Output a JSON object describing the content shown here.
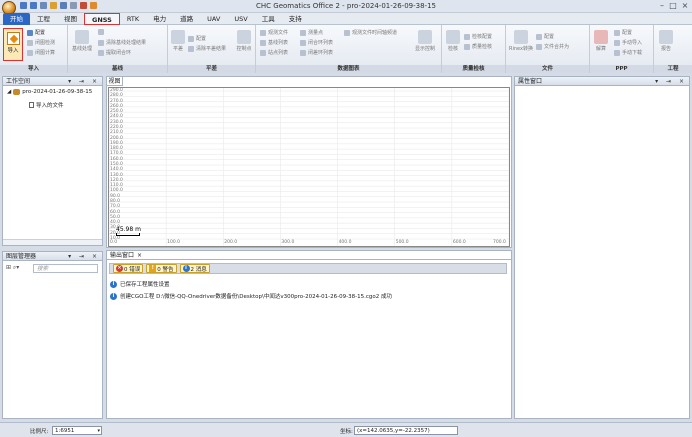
{
  "window": {
    "title": "CHC Geomatics Office 2 - pro-2024-01-26-09-38-15"
  },
  "tabs": [
    "开始",
    "工程",
    "视图",
    "GNSS",
    "RTK",
    "电力",
    "道路",
    "UAV",
    "USV",
    "工具",
    "支持"
  ],
  "ribbon": {
    "import_label": "导入",
    "col1": [
      "配置",
      "闭图检测",
      "闭图计算"
    ],
    "group_project": "导入",
    "col2": [
      "基线处理",
      "清除基线处理结果",
      "提取闭合环"
    ],
    "group_baseline": "基线",
    "col3": [
      "平差",
      "配置",
      "清除平差结果",
      "控制点"
    ],
    "group_adjust": "平差",
    "col4": [
      "观测文件",
      "基线列表",
      "站点列表",
      "测量点",
      "闭合环列表",
      "闭差环列表",
      "观测文件时间轴频道"
    ],
    "show_control": "显示控制",
    "group_table": "数据图表",
    "col5": [
      "检核",
      "检核配置",
      "质量检核"
    ],
    "group_quality": "质量检核",
    "col6": [
      "Rinex转换",
      "配置",
      "文件合并为"
    ],
    "group_file": "文件",
    "col7": [
      "PPP",
      "解算",
      "配置",
      "手动导入",
      "手动下载"
    ],
    "group_ppp": "PPP",
    "col8": [
      "报告"
    ],
    "group_project2": "工程"
  },
  "workspace": {
    "title": "工作空间",
    "project": "pro-2024-01-26-09-38-15",
    "child": "导入的文件"
  },
  "layers": {
    "title": "图层管理器",
    "search_placeholder": "搜索"
  },
  "view": {
    "tab": "视图",
    "y_ticks": [
      "290.0",
      "280.0",
      "270.0",
      "260.0",
      "250.0",
      "240.0",
      "230.0",
      "220.0",
      "210.0",
      "200.0",
      "190.0",
      "180.0",
      "170.0",
      "160.0",
      "150.0",
      "140.0",
      "130.0",
      "120.0",
      "110.0",
      "100.0",
      "90.0",
      "80.0",
      "70.0",
      "60.0",
      "50.0",
      "40.0",
      "30.0",
      "20.0",
      "10.0"
    ],
    "x_ticks": [
      "0.0",
      "100.0",
      "200.0",
      "300.0",
      "400.0",
      "500.0",
      "600.0",
      "700.0"
    ],
    "scale": "45.98 m"
  },
  "output": {
    "tab": "输出窗口",
    "errors": "0 错误",
    "warnings": "0 警告",
    "messages": "2 消息",
    "lines": [
      "已保存工程属性设置",
      "创建CGO工程 D:\\微信-QQ-Onedriver数据备份\\Desktop\\中闻达v300pro-2024-01-26-09-38-15.cgo2 成功"
    ]
  },
  "props": {
    "title": "属性窗口"
  },
  "status": {
    "scale_label": "比例尺:",
    "scale_value": "1:6951",
    "coord_label": "坐标:",
    "coord_value": "(x=142.0635,y=-22.2357)"
  }
}
